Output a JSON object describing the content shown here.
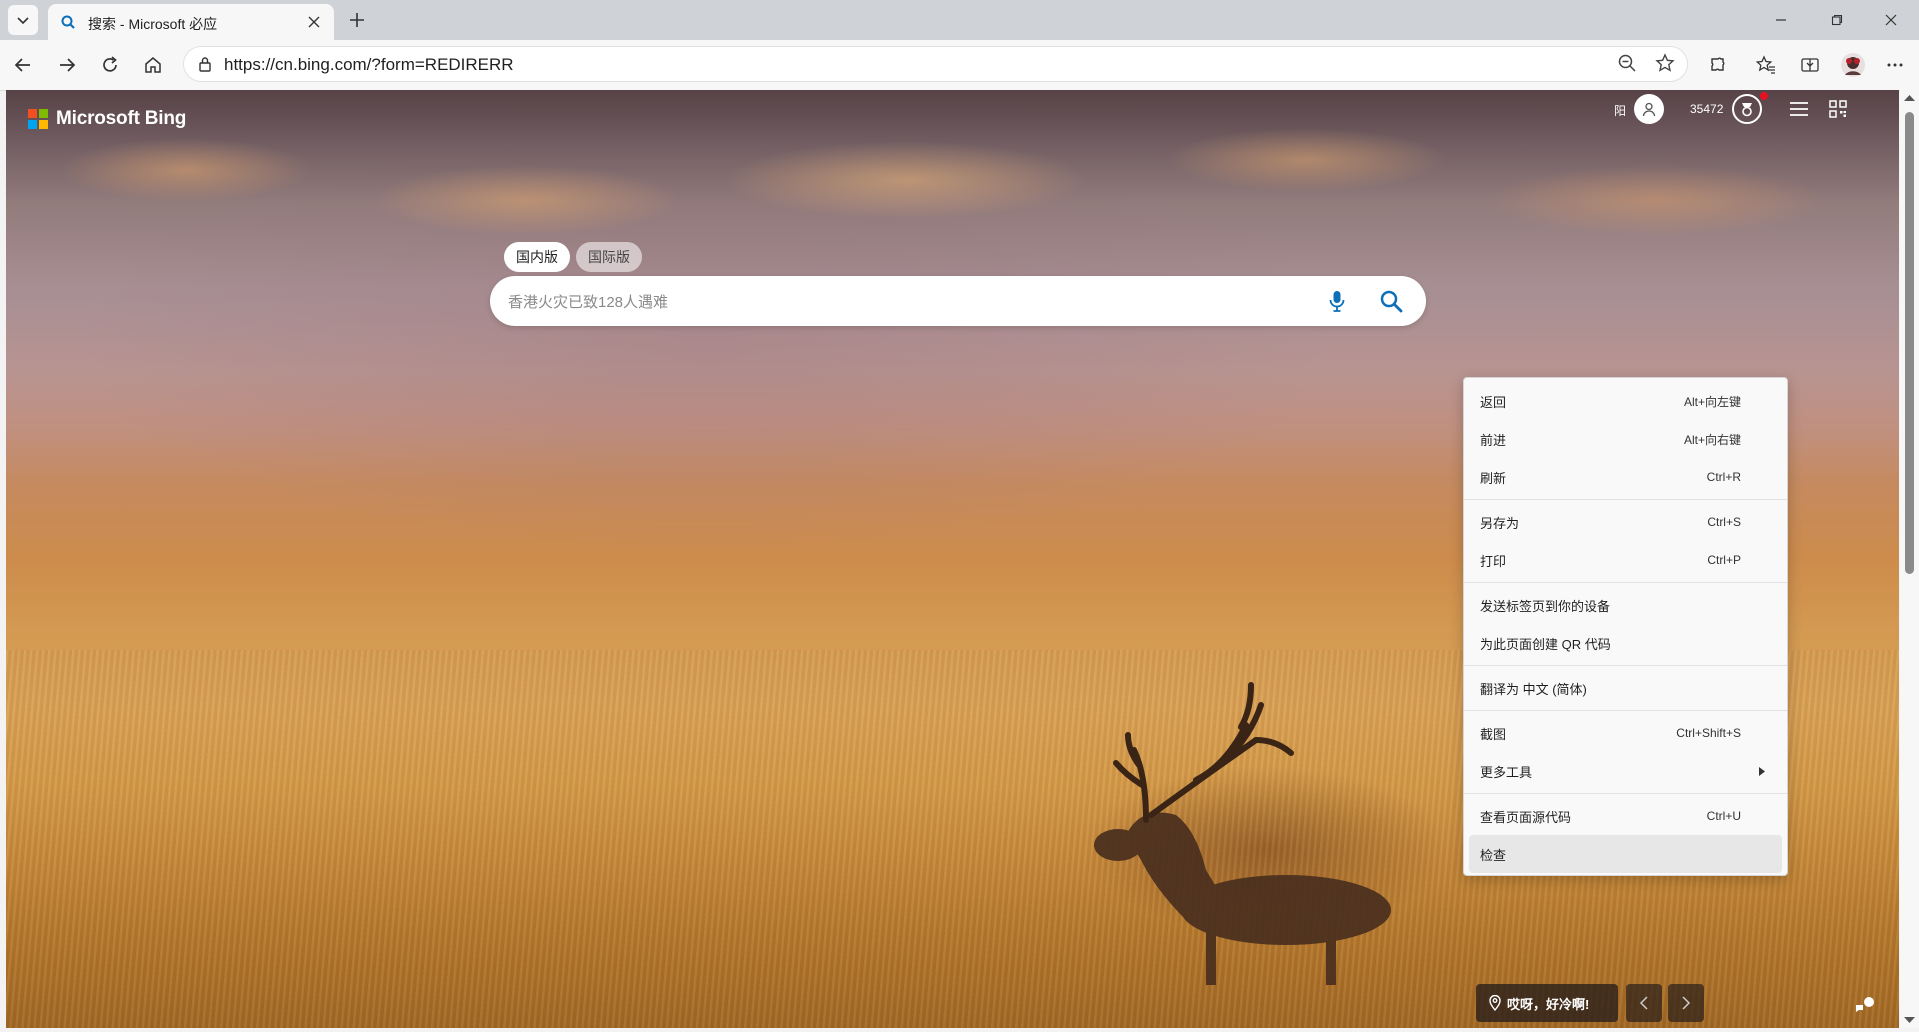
{
  "browser": {
    "tab_title": "搜索 - Microsoft 必应",
    "url": "https://cn.bing.com/?form=REDIRERR"
  },
  "bing": {
    "logo_text": "Microsoft Bing",
    "login_text": "阳",
    "points": "35472",
    "scope_tabs": [
      "国内版",
      "国际版"
    ],
    "search_placeholder": "香港火灾已致128人遇难",
    "weather_text": "哎呀，好冷啊!"
  },
  "context_menu": {
    "items": [
      {
        "label": "返回",
        "shortcut": "Alt+向左键"
      },
      {
        "label": "前进",
        "shortcut": "Alt+向右键"
      },
      {
        "label": "刷新",
        "shortcut": "Ctrl+R"
      },
      {
        "label": "另存为",
        "shortcut": "Ctrl+S"
      },
      {
        "label": "打印",
        "shortcut": "Ctrl+P"
      },
      {
        "label": "发送标签页到你的设备",
        "shortcut": ""
      },
      {
        "label": "为此页面创建 QR 代码",
        "shortcut": ""
      },
      {
        "label": "翻译为 中文 (简体)",
        "shortcut": ""
      },
      {
        "label": "截图",
        "shortcut": "Ctrl+Shift+S"
      },
      {
        "label": "更多工具",
        "shortcut": ""
      },
      {
        "label": "查看页面源代码",
        "shortcut": "Ctrl+U"
      },
      {
        "label": "检查",
        "shortcut": ""
      }
    ]
  },
  "colors": {
    "ms_red": "#f25022",
    "ms_green": "#7fba00",
    "ms_blue": "#00a4ef",
    "ms_yellow": "#ffb900",
    "bing_blue": "#0c6fb8",
    "rewards_badge": "#e81123"
  },
  "icons": [
    "tab-actions-icon",
    "bing-favicon",
    "close-icon",
    "plus-icon",
    "minimize-icon",
    "maximize-icon",
    "back-icon",
    "forward-icon",
    "refresh-icon",
    "home-icon",
    "lock-icon",
    "zoom-out-icon",
    "star-icon",
    "extensions-icon",
    "favorites-icon",
    "split-screen-icon",
    "profile-avatar",
    "more-icon",
    "user-icon",
    "rewards-icon",
    "hamburger-icon",
    "qr-code-icon",
    "microphone-icon",
    "search-icon",
    "location-icon",
    "chevron-left-icon",
    "chevron-right-icon",
    "feedback-icon",
    "chevron-right-submenu-icon"
  ]
}
